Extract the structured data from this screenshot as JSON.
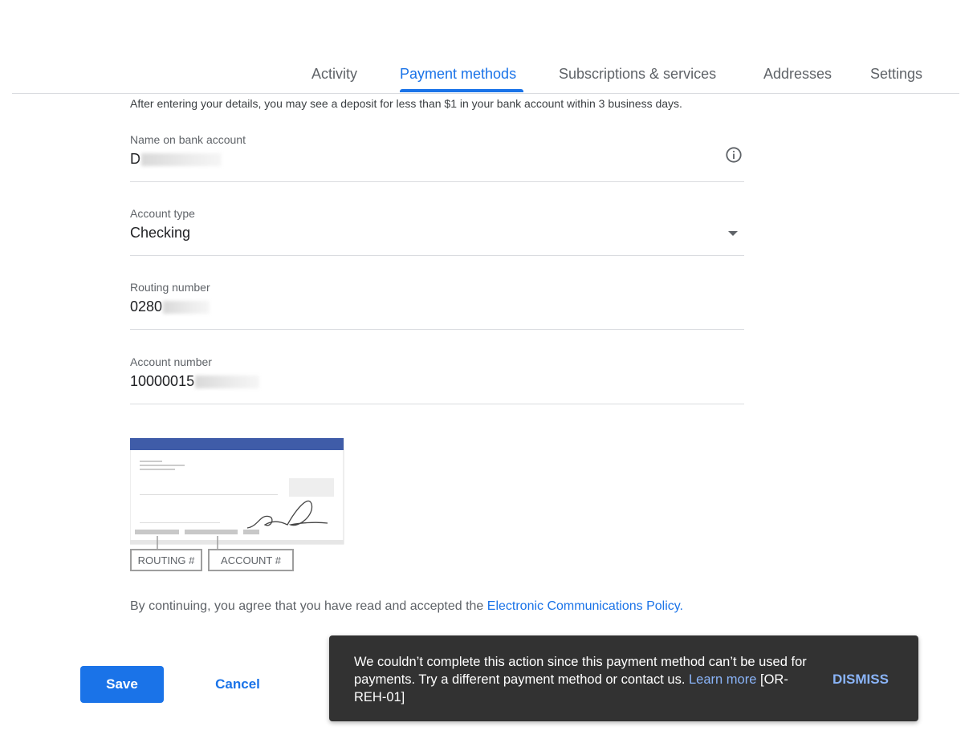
{
  "tabs": [
    {
      "label": "Activity",
      "active": false
    },
    {
      "label": "Payment methods",
      "active": true
    },
    {
      "label": "Subscriptions & services",
      "active": false
    },
    {
      "label": "Addresses",
      "active": false
    },
    {
      "label": "Settings",
      "active": false
    }
  ],
  "notice": "After entering your details, you may see a deposit for less than $1 in your bank account within 3 business days.",
  "form": {
    "name": {
      "label": "Name on bank account",
      "value": "D"
    },
    "account_type": {
      "label": "Account type",
      "value": "Checking"
    },
    "routing": {
      "label": "Routing number",
      "value": "0280"
    },
    "account": {
      "label": "Account number",
      "value": "10000015"
    }
  },
  "check": {
    "routing_label": "ROUTING #",
    "account_label": "ACCOUNT #"
  },
  "agreement": {
    "prefix": "By continuing, you agree that you have read and accepted the ",
    "link": "Electronic Communications Policy."
  },
  "buttons": {
    "save": "Save",
    "cancel": "Cancel"
  },
  "snackbar": {
    "message": "We couldn’t complete this action since this payment method can’t be used for payments. Try a different payment method or contact us.",
    "learn_more": "Learn more",
    "code": "[OR-REH-01]",
    "dismiss": "DISMISS"
  },
  "colors": {
    "accent": "#1a73e8",
    "snackbar_bg": "#323232",
    "snackbar_link": "#8ab4f8",
    "check_header": "#3f5ca8"
  }
}
